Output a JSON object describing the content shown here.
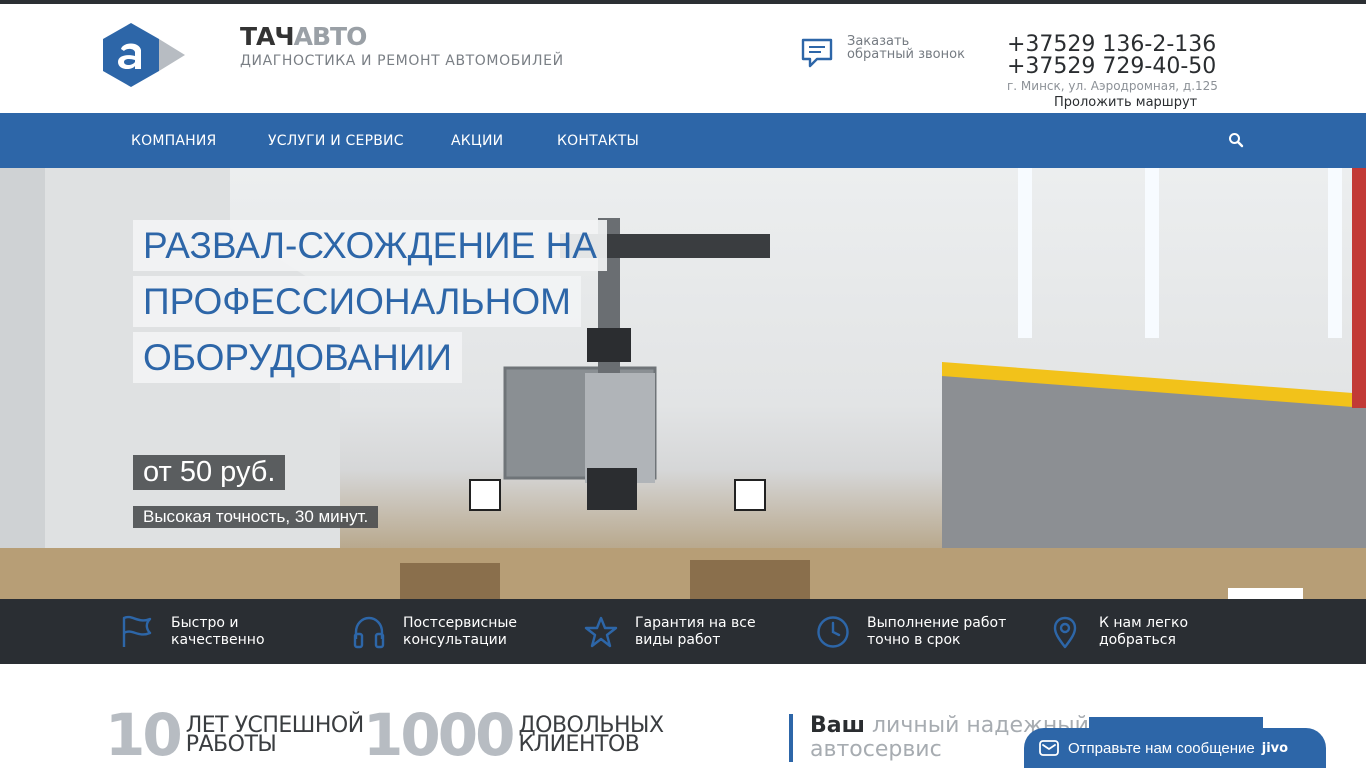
{
  "header": {
    "brand_part1": "ТАЧ",
    "brand_part2": "АВТО",
    "tagline": "ДИАГНОСТИКА И РЕМОНТ АВТОМОБИЛЕЙ",
    "callback_line1": "Заказать",
    "callback_line2": "обратный звонок",
    "phone1": "+37529 136-2-136",
    "phone2": "+37529 729-40-50",
    "address": "г. Минск, ул. Аэродромная, д.125",
    "route_link": "Проложить маршрут"
  },
  "nav": {
    "items": [
      "КОМПАНИЯ",
      "УСЛУГИ И СЕРВИС",
      "АКЦИИ",
      "КОНТАКТЫ"
    ],
    "search_icon": "search-icon"
  },
  "hero": {
    "title_lines": [
      "РАЗВАЛ-СХОЖДЕНИЕ НА",
      "ПРОФЕССИОНАЛЬНОМ",
      "ОБОРУДОВАНИИ"
    ],
    "price": "от 50 руб.",
    "subtitle": "Высокая точность, 30 минут."
  },
  "features": [
    {
      "icon": "flag-icon",
      "line1": "Быстро и",
      "line2": "качественно"
    },
    {
      "icon": "headphones-icon",
      "line1": "Постсервисные",
      "line2": "консультации"
    },
    {
      "icon": "star-icon",
      "line1": "Гарантия на все",
      "line2": "виды работ"
    },
    {
      "icon": "clock-icon",
      "line1": "Выполнение работ",
      "line2": "точно в срок"
    },
    {
      "icon": "map-pin-icon",
      "line1": "К нам легко",
      "line2": "добраться"
    }
  ],
  "stats": [
    {
      "number": "10",
      "label_line1": "ЛЕТ УСПЕШНОЙ",
      "label_line2": "РАБОТЫ"
    },
    {
      "number": "1000",
      "label_line1": "ДОВОЛЬНЫХ",
      "label_line2": "КЛИЕНТОВ"
    }
  ],
  "slogan": {
    "bold": "Ваш",
    "rest_line1": "личный надежный",
    "rest_line2": "автосервис"
  },
  "chat": {
    "label": "Отправьте нам сообщение",
    "brand": "jivo"
  },
  "colors": {
    "brand_blue": "#2d66a8",
    "dark_bar": "#2a2e33",
    "stat_grey": "#b7bcc2"
  }
}
